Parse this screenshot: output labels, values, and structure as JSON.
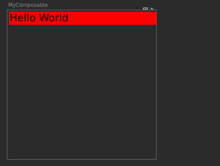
{
  "preview": {
    "title": "MyComposable",
    "text": "Hello World",
    "icons": [
      "deploy-preview-icon",
      "interactive-mode-icon"
    ]
  },
  "colors": {
    "text_background": "#ff0000",
    "text_color": "#000000",
    "canvas_background": "#2b2b2b",
    "title_color": "#8b8b8b"
  }
}
